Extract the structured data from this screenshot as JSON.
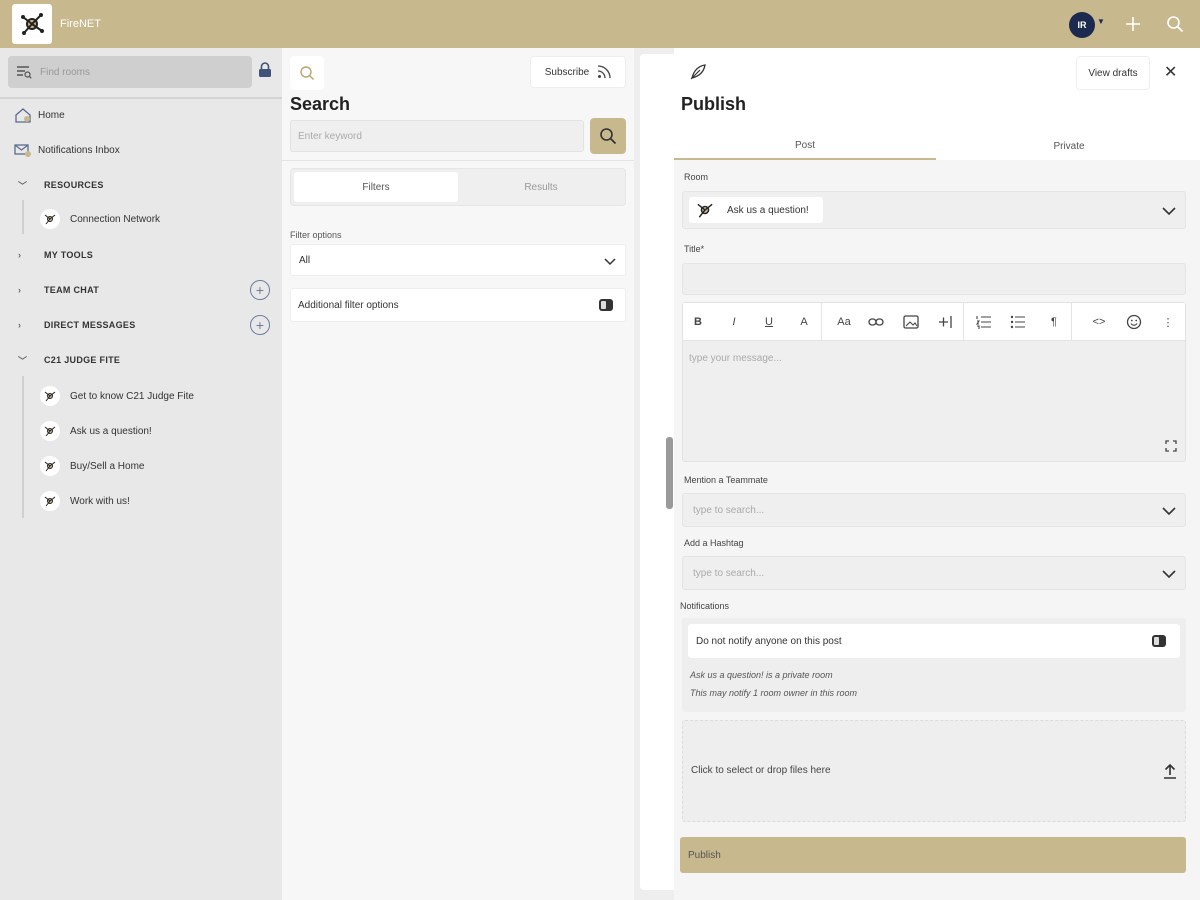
{
  "app": {
    "title": "FireNET",
    "avatar_initials": "IR",
    "accent": "#c8b88e",
    "avatar_color": "#1c2a4f"
  },
  "sidebar": {
    "search_placeholder": "Find rooms",
    "home": "Home",
    "notifications": "Notifications Inbox",
    "sections": {
      "resources": "RESOURCES",
      "my_tools": "MY TOOLS",
      "team_chat": "TEAM CHAT",
      "direct_messages": "DIRECT MESSAGES",
      "judge_fite": "C21 JUDGE FITE"
    },
    "resources_items": [
      "Connection Network"
    ],
    "judge_fite_items": [
      "Get to know C21 Judge Fite",
      "Ask us a question!",
      "Buy/Sell a Home",
      "Work with us!"
    ]
  },
  "search_panel": {
    "subscribe": "Subscribe",
    "title": "Search",
    "keyword_placeholder": "Enter keyword",
    "tabs": [
      "Filters",
      "Results"
    ],
    "filter_options_label": "Filter options",
    "filter_value": "All",
    "additional_filters": "Additional filter options"
  },
  "publish": {
    "view_drafts": "View drafts",
    "title": "Publish",
    "tabs": [
      "Post",
      "Private"
    ],
    "room_label": "Room",
    "room_value": "Ask us a question!",
    "title_label": "Title*",
    "toolbar": [
      "B",
      "I",
      "U",
      "A",
      "Aa",
      "link",
      "image",
      "+",
      "ordered-list",
      "bullet-list",
      "¶",
      "<>",
      "emoji",
      "⋮"
    ],
    "message_placeholder": "type your message...",
    "mention_label": "Mention a Teammate",
    "mention_placeholder": "type to search...",
    "hashtag_label": "Add a Hashtag",
    "hashtag_placeholder": "type to search...",
    "notifications_label": "Notifications",
    "notify_toggle": "Do not notify anyone on this post",
    "notify_note_1": "Ask us a question! is a private room",
    "notify_note_2": "This may notify 1 room owner in this room",
    "drop_text": "Click to select or drop files here",
    "publish_button": "Publish"
  }
}
